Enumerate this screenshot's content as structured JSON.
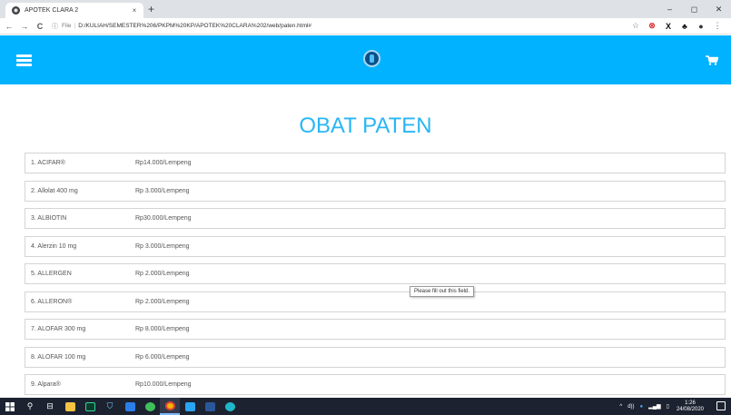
{
  "browser": {
    "tab_title": "APOTEK CLARA 2",
    "tab_close": "×",
    "new_tab": "+",
    "window_controls": [
      "–",
      "◻",
      "✕"
    ],
    "nav": {
      "back": "←",
      "forward": "→",
      "reload": "C"
    },
    "address": {
      "info_icon": "ⓘ",
      "scheme_label": "File",
      "url": "D:/KULIAH/SEMESTER%206/PKPM%20KP/APOTEK%20CLARA%202/web/paten.html#"
    },
    "extensions": [
      "☆",
      "⊗",
      "X",
      "♣",
      "●",
      "⋮"
    ]
  },
  "header": {
    "menu_icon": "hamburger-icon",
    "logo_icon": "apotek-logo",
    "cart_icon": "cart-icon",
    "color": "#00b2ff"
  },
  "page": {
    "title": "OBAT PATEN",
    "title_color": "#29b6f6",
    "items": [
      {
        "name": "1. ACIFAR®",
        "price": "Rp14.000/Lempeng"
      },
      {
        "name": "2. Allolat 400 mg",
        "price": "Rp 3.000/Lempeng"
      },
      {
        "name": "3. ALBIOTIN",
        "price": "Rp30.000/Lempeng"
      },
      {
        "name": "4. Alerzin 10 mg",
        "price": "Rp 3.000/Lempeng"
      },
      {
        "name": "5. ALLERGEN",
        "price": "Rp 2.000/Lempeng"
      },
      {
        "name": "6. ALLERON®",
        "price": "Rp 2.000/Lempeng"
      },
      {
        "name": "7. ALOFAR 300 mg",
        "price": "Rp 8.000/Lempeng"
      },
      {
        "name": "8. ALOFAR 100 mg",
        "price": "Rp 6.000/Lempeng"
      },
      {
        "name": "9. Alpara®",
        "price": "Rp10.000/Lempeng"
      }
    ],
    "tooltip": "Please fill out this field."
  },
  "taskbar": {
    "icons": [
      "windows-start",
      "search",
      "task-view",
      "file-explorer",
      "audition",
      "vpn",
      "mail",
      "green-app",
      "chrome",
      "media",
      "word",
      "edge"
    ],
    "tray": {
      "chevron": "^",
      "volume": "d))",
      "time": "1:26",
      "date": "24/08/2020"
    }
  }
}
